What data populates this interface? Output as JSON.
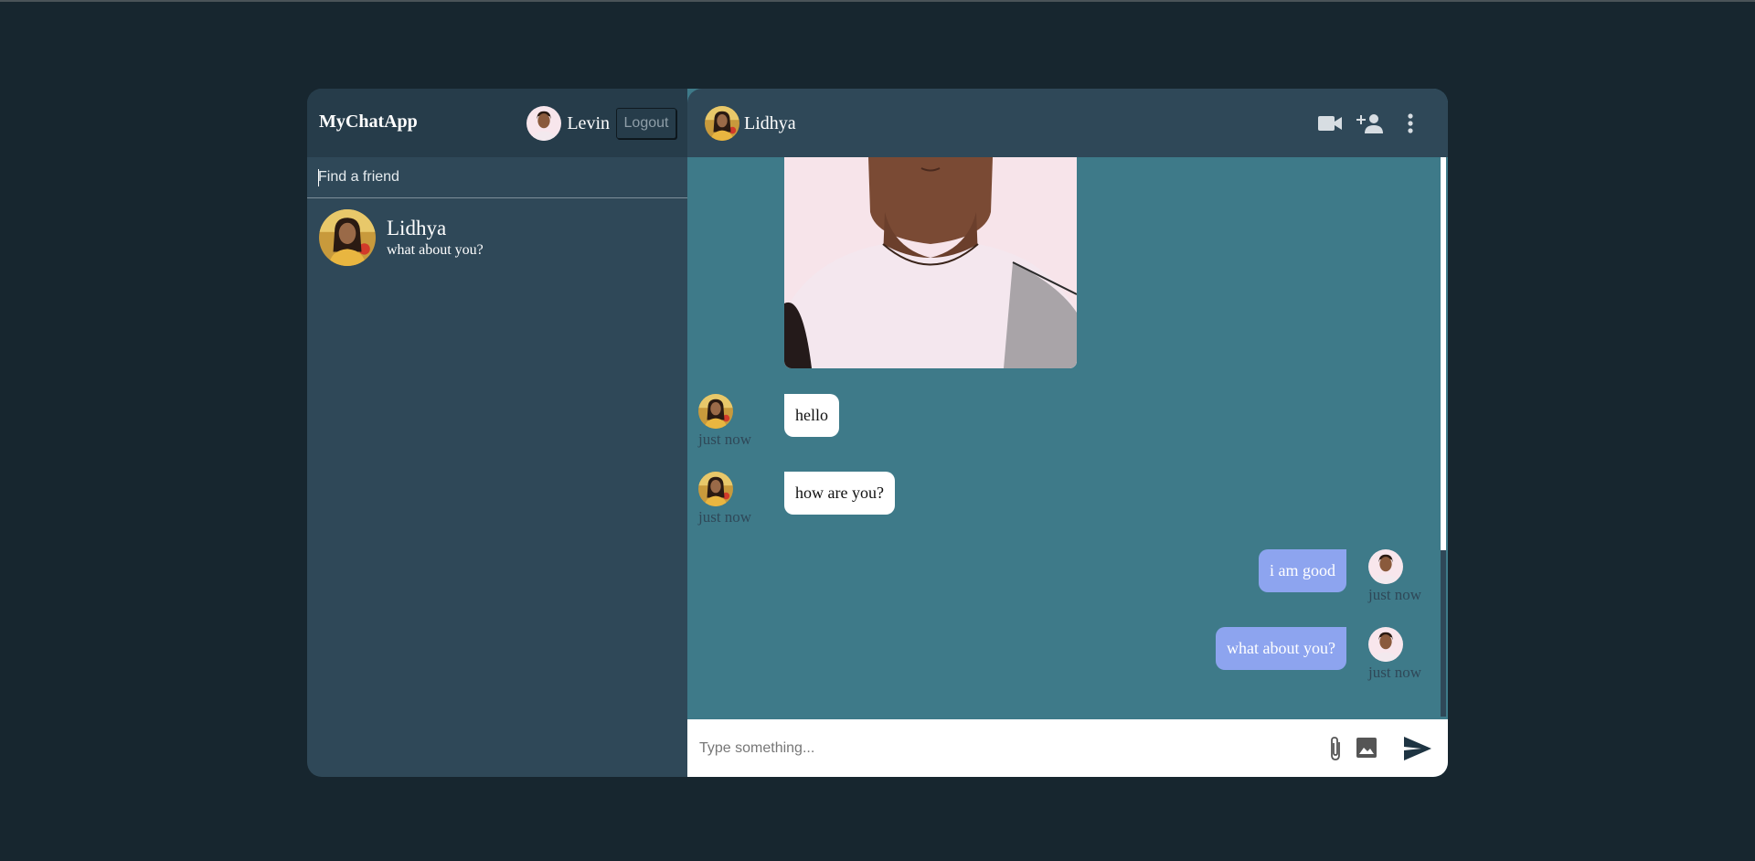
{
  "app": {
    "title": "MyChatApp"
  },
  "current_user": {
    "name": "Levin",
    "logout_label": "Logout"
  },
  "search": {
    "placeholder": "Find a friend",
    "value": ""
  },
  "contacts": [
    {
      "name": "Lidhya",
      "last_message": "what about you?"
    }
  ],
  "chat": {
    "header": {
      "name": "Lidhya"
    },
    "icons": [
      "video-camera-icon",
      "add-person-icon",
      "more-vertical-icon"
    ],
    "messages": [
      {
        "direction": "in",
        "type": "image",
        "text": ""
      },
      {
        "direction": "in",
        "type": "text",
        "text": "hello",
        "time": "just now"
      },
      {
        "direction": "in",
        "type": "text",
        "text": "how are you?",
        "time": "just now"
      },
      {
        "direction": "out",
        "type": "text",
        "text": "i am good",
        "time": "just now"
      },
      {
        "direction": "out",
        "type": "text",
        "text": "what about you?",
        "time": "just now"
      }
    ],
    "input": {
      "placeholder": "Type something...",
      "value": ""
    },
    "input_icons": [
      "attachment-icon",
      "image-icon",
      "send-icon"
    ]
  },
  "colors": {
    "background": "#17262f",
    "sidebar": "#2f4858",
    "sidebar_header": "#263c4a",
    "chat_area": "#3e7a89",
    "incoming_bubble": "#ffffff",
    "outgoing_bubble": "#8da4ef",
    "timestamp": "#2f4858"
  }
}
